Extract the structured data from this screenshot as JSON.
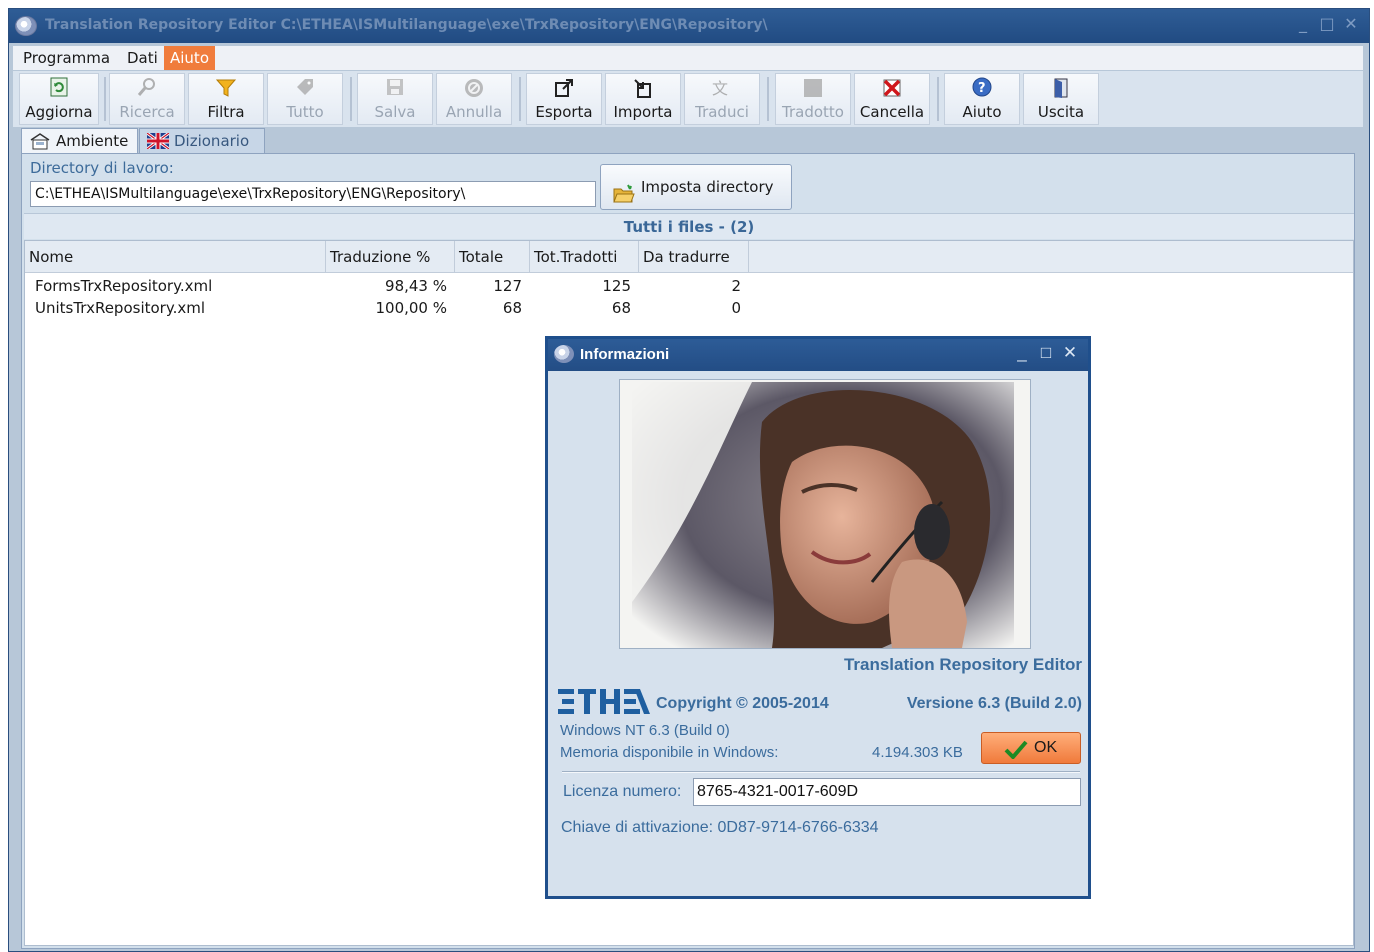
{
  "window": {
    "title": "Translation Repository Editor C:\\ETHEA\\ISMultilanguage\\exe\\TrxRepository\\ENG\\Repository\\",
    "controls": [
      "_",
      "□",
      "✕"
    ]
  },
  "menu": {
    "items": [
      {
        "label": "Programma"
      },
      {
        "label": "Dati"
      },
      {
        "label": "Aiuto",
        "active": true
      }
    ]
  },
  "toolbar": {
    "buttons": [
      {
        "label": "Aggiorna",
        "icon": "refresh-icon",
        "enabled": true
      },
      {
        "label": "Ricerca",
        "icon": "search-icon",
        "enabled": false
      },
      {
        "label": "Filtra",
        "icon": "filter-icon",
        "enabled": true
      },
      {
        "label": "Tutto",
        "icon": "tag-icon",
        "enabled": false
      },
      {
        "label": "Salva",
        "icon": "save-icon",
        "enabled": false
      },
      {
        "label": "Annulla",
        "icon": "cancel-icon",
        "enabled": false
      },
      {
        "label": "Esporta",
        "icon": "export-icon",
        "enabled": true
      },
      {
        "label": "Importa",
        "icon": "import-icon",
        "enabled": true
      },
      {
        "label": "Traduci",
        "icon": "translate-icon",
        "enabled": false
      },
      {
        "label": "Tradotto",
        "icon": "translated-icon",
        "enabled": false
      },
      {
        "label": "Cancella",
        "icon": "delete-icon",
        "enabled": true
      },
      {
        "label": "Aiuto",
        "icon": "help-icon",
        "enabled": true
      },
      {
        "label": "Uscita",
        "icon": "exit-door-icon",
        "enabled": true
      }
    ]
  },
  "tabs": [
    {
      "label": "Ambiente",
      "icon": "environment-icon",
      "selected": true
    },
    {
      "label": "Dizionario",
      "icon": "uk-flag-icon",
      "selected": false
    }
  ],
  "environment": {
    "dir_label": "Directory di lavoro:",
    "dir_value": "C:\\ETHEA\\ISMultilanguage\\exe\\TrxRepository\\ENG\\Repository\\",
    "set_dir_button": "Imposta directory",
    "files_header": "Tutti i files - (2)"
  },
  "grid": {
    "columns": [
      "Nome",
      "Traduzione %",
      "Totale",
      "Tot.Tradotti",
      "Da tradurre"
    ],
    "rows": [
      [
        "FormsTrxRepository.xml",
        "98,43 %",
        "127",
        "125",
        "2"
      ],
      [
        "UnitsTrxRepository.xml",
        "100,00 %",
        "68",
        "68",
        "0"
      ]
    ]
  },
  "about_dialog": {
    "title": "Informazioni",
    "controls": [
      "_",
      "□",
      "✕"
    ],
    "product_name": "Translation Repository Editor",
    "logo_text": "ETHEA",
    "copyright": "Copyright © 2005-2014",
    "version": "Versione 6.3 (Build 2.0)",
    "os_info": "Windows NT 6.3 (Build 0)",
    "memory_label": "Memoria disponibile in Windows:",
    "memory_value": "4.194.303 KB",
    "ok_label": "OK",
    "license_label": "Licenza numero:",
    "license_value": "8765-4321-0017-609D",
    "activation_key": "Chiave di attivazione: 0D87-9714-6766-6334"
  },
  "colors": {
    "titlebar": "#214b82",
    "accent_orange": "#f07c3c",
    "text_blue": "#3b6c9d",
    "panel": "#d3e0ec"
  }
}
